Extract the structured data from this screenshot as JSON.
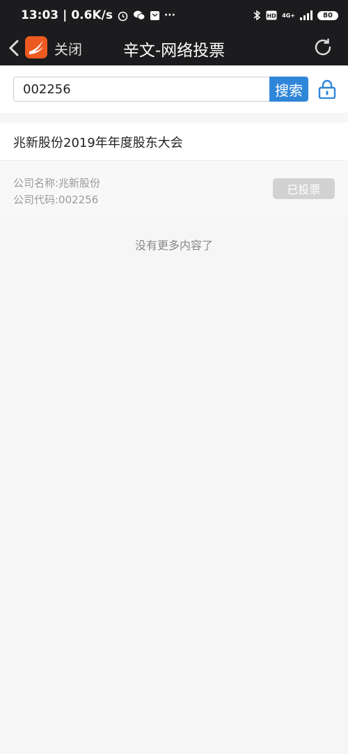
{
  "status_bar": {
    "time": "13:03",
    "net_speed": "0.6K/s",
    "network": "4G+",
    "battery": "80"
  },
  "top_bar": {
    "close_label": "关闭",
    "title": "辛文-网络投票"
  },
  "search": {
    "value": "002256",
    "button_label": "搜索"
  },
  "result": {
    "meeting_title": "兆新股份2019年年度股东大会",
    "company_name_line": "公司名称:兆新股份",
    "company_code_line": "公司代码:002256",
    "vote_button_label": "已投票"
  },
  "footer": {
    "no_more_text": "没有更多内容了"
  },
  "colors": {
    "accent": "#2f86d8",
    "app_logo": "#ec5a21",
    "header_bg": "#1c1c1e"
  }
}
